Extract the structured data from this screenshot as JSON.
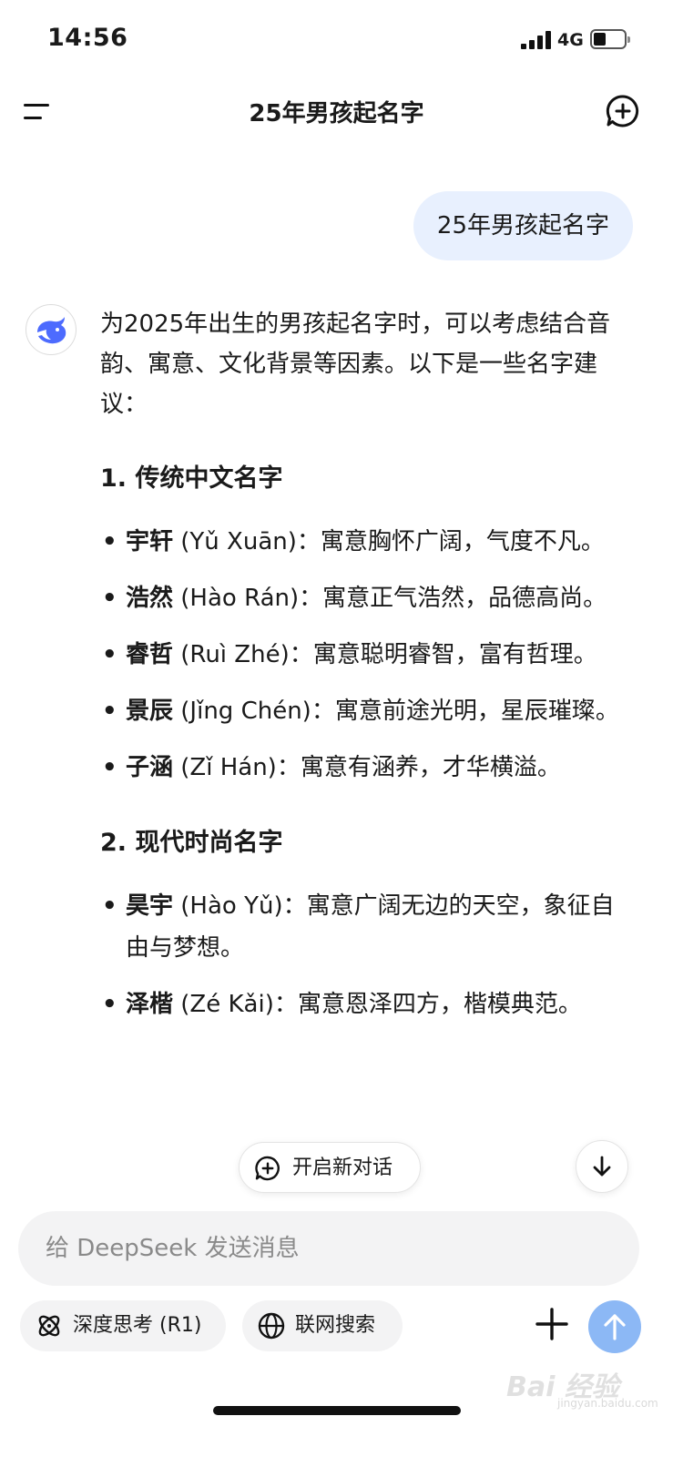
{
  "status_bar": {
    "time": "14:56",
    "network": "4G"
  },
  "header": {
    "title": "25年男孩起名字",
    "menu_icon": "menu-icon",
    "new_chat_icon": "chat-plus-icon"
  },
  "conversation": {
    "user_message": "25年男孩起名字",
    "assistant": {
      "intro": "为2025年出生的男孩起名字时，可以考虑结合音韵、寓意、文化背景等因素。以下是一些名字建议：",
      "sections": [
        {
          "title": "1. 传统中文名字",
          "items": [
            {
              "name": "宇轩",
              "pinyin": "(Yǔ Xuān)",
              "meaning": "：寓意胸怀广阔，气度不凡。"
            },
            {
              "name": "浩然",
              "pinyin": "(Hào Rán)",
              "meaning": "：寓意正气浩然，品德高尚。"
            },
            {
              "name": "睿哲",
              "pinyin": "(Ruì Zhé)",
              "meaning": "：寓意聪明睿智，富有哲理。"
            },
            {
              "name": "景辰",
              "pinyin": "(Jǐng Chén)",
              "meaning": "：寓意前途光明，星辰璀璨。"
            },
            {
              "name": "子涵",
              "pinyin": "(Zǐ Hán)",
              "meaning": "：寓意有涵养，才华横溢。"
            }
          ]
        },
        {
          "title": "2. 现代时尚名字",
          "items": [
            {
              "name": "昊宇",
              "pinyin": "(Hào Yǔ)",
              "meaning": "：寓意广阔无边的天空，象征自由与梦想。"
            },
            {
              "name": "泽楷",
              "pinyin": "(Zé Kǎi)",
              "meaning": "：寓意恩泽四方，楷模典范。"
            }
          ]
        }
      ]
    }
  },
  "floating": {
    "new_chat_label": "开启新对话",
    "scroll_down_icon": "arrow-down-icon"
  },
  "composer": {
    "placeholder": "给 DeepSeek 发送消息",
    "deep_think_label": "深度思考 (R1)",
    "web_search_label": "联网搜索",
    "attach_icon": "plus-icon",
    "send_icon": "arrow-up-icon"
  },
  "watermark": {
    "text": "Bai 经验",
    "sub": "jingyan.baidu.com"
  },
  "colors": {
    "user_bubble": "#e8f0fe",
    "send_button": "#8cb8f5",
    "brand_blue": "#4d6bfe",
    "composer_bg": "#f3f3f4"
  }
}
